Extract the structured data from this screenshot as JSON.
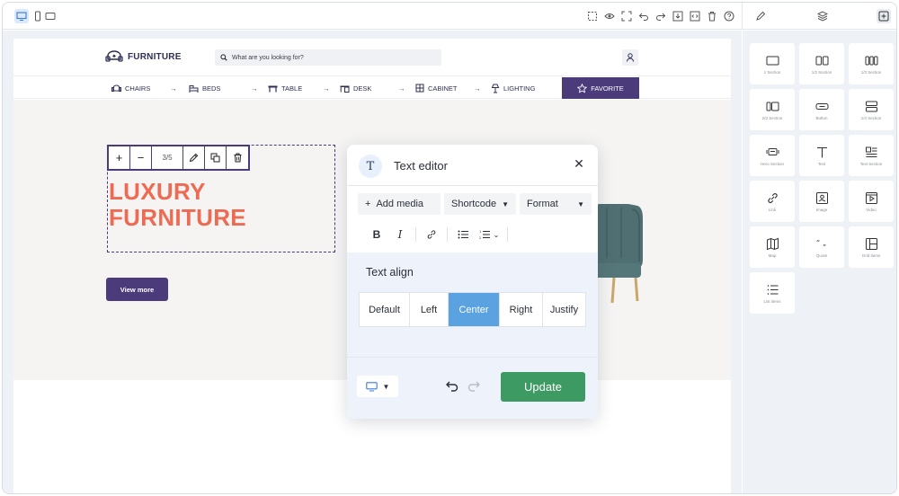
{
  "site": {
    "logo_text": "FURNITURE",
    "search_placeholder": "What are you looking for?",
    "categories": [
      {
        "label": "CHAIRS"
      },
      {
        "label": "BEDS"
      },
      {
        "label": "TABLE"
      },
      {
        "label": "DESK"
      },
      {
        "label": "CABINET"
      },
      {
        "label": "LIGHTING"
      },
      {
        "label": "FAVORITE"
      }
    ],
    "hero_title_line1": "LUXURY",
    "hero_title_line2": "FURNITURE",
    "view_more": "View more",
    "element_toolbar": {
      "counter": "3/5"
    }
  },
  "editor": {
    "title": "Text editor",
    "add_media": "Add media",
    "shortcode": "Shortcode",
    "format": "Format",
    "align_title": "Text align",
    "align_options": [
      "Default",
      "Left",
      "Center",
      "Right",
      "Justify"
    ],
    "align_selected": "Center",
    "update": "Update"
  },
  "blocks": [
    {
      "label": "1 Section",
      "icon": "one-section-icon"
    },
    {
      "label": "1/2 Section",
      "icon": "half-section-icon"
    },
    {
      "label": "1/3 Section",
      "icon": "third-section-icon"
    },
    {
      "label": "2/3 Section",
      "icon": "two-thirds-section-icon"
    },
    {
      "label": "Button",
      "icon": "button-icon"
    },
    {
      "label": "1/4 Section",
      "icon": "quarter-section-icon"
    },
    {
      "label": "Hero Section",
      "icon": "hero-section-icon"
    },
    {
      "label": "Text",
      "icon": "text-icon"
    },
    {
      "label": "Text Section",
      "icon": "text-section-icon"
    },
    {
      "label": "Link",
      "icon": "link-icon"
    },
    {
      "label": "Image",
      "icon": "image-icon"
    },
    {
      "label": "Video",
      "icon": "video-icon"
    },
    {
      "label": "Map",
      "icon": "map-icon"
    },
    {
      "label": "Quote",
      "icon": "quote-icon"
    },
    {
      "label": "Grid items",
      "icon": "grid-items-icon"
    },
    {
      "label": "List items",
      "icon": "list-items-icon"
    }
  ],
  "colors": {
    "brand": "#4b3b7a",
    "accent": "#ee6b53",
    "selected": "#5aa2e0",
    "update": "#3e9a63"
  }
}
